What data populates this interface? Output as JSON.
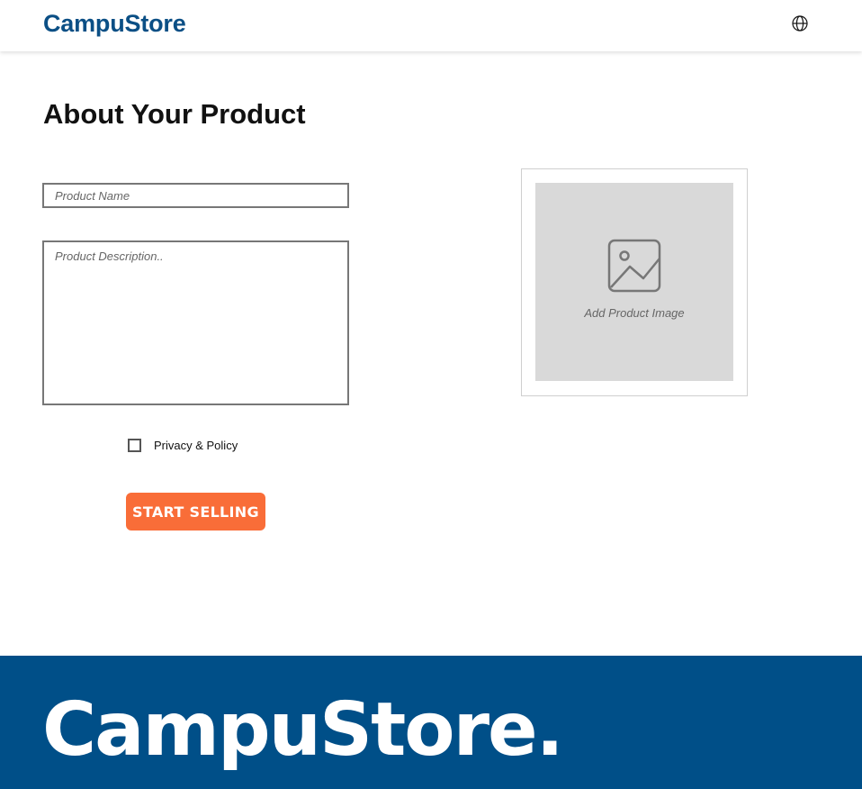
{
  "header": {
    "brand": "CampuStore",
    "globe_icon": "globe-icon"
  },
  "main": {
    "title": "About Your Product",
    "product_name": {
      "placeholder": "Product Name",
      "value": ""
    },
    "product_description": {
      "placeholder": "Product Description..",
      "value": ""
    },
    "privacy": {
      "label": "Privacy & Policy",
      "checked": false
    },
    "start_selling_label": "START SELLING",
    "image_upload": {
      "label": "Add Product Image",
      "icon": "image-placeholder-icon"
    }
  },
  "footer": {
    "brand": "CampuStore."
  },
  "colors": {
    "brand_blue": "#0b4f85",
    "footer_blue": "#004f88",
    "accent_orange": "#f96d38",
    "image_bg": "#d9d9d9"
  }
}
